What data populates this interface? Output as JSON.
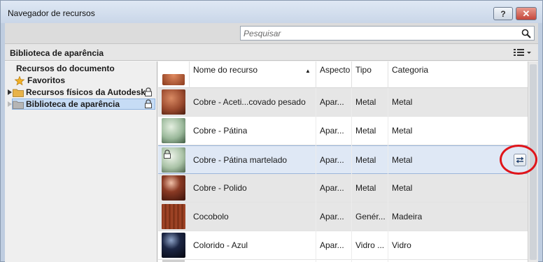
{
  "window": {
    "title": "Navegador de recursos",
    "help_label": "?",
    "close_label": "✕"
  },
  "search": {
    "placeholder": "Pesquisar"
  },
  "library": {
    "title": "Biblioteca de aparência"
  },
  "tree": [
    {
      "label": "Recursos do documento"
    },
    {
      "label": "Favoritos"
    },
    {
      "label": "Recursos físicos da Autodesk"
    },
    {
      "label": "Biblioteca de aparência"
    }
  ],
  "columns": {
    "name": "Nome do recurso",
    "aspect": "Aspecto",
    "type": "Tipo",
    "category": "Categoria",
    "sort_indicator": "▲"
  },
  "rows": [
    {
      "name": "Cobre - Aceti...covado pesado",
      "aspect": "Apar...",
      "type": "Metal",
      "category": "Metal",
      "thumb_color": "#9a4a2e"
    },
    {
      "name": "Cobre - Pátina",
      "aspect": "Apar...",
      "type": "Metal",
      "category": "Metal",
      "thumb_color": "#9ab89a"
    },
    {
      "name": "Cobre - Pátina martelado",
      "aspect": "Apar...",
      "type": "Metal",
      "category": "Metal",
      "thumb_color": "#a9c2a6"
    },
    {
      "name": "Cobre - Polido",
      "aspect": "Apar...",
      "type": "Metal",
      "category": "Metal",
      "thumb_color": "#6b2a1a"
    },
    {
      "name": "Cocobolo",
      "aspect": "Apar...",
      "type": "Genér...",
      "category": "Madeira",
      "thumb_color": "#8a3418"
    },
    {
      "name": "Colorido - Azul",
      "aspect": "Apar...",
      "type": "Vidro ...",
      "category": "Vidro",
      "thumb_color": "#0c1224"
    }
  ],
  "colors": {
    "highlight": "#e0141a",
    "selection": "#c6dcf5",
    "folder": "#e8b34a"
  }
}
